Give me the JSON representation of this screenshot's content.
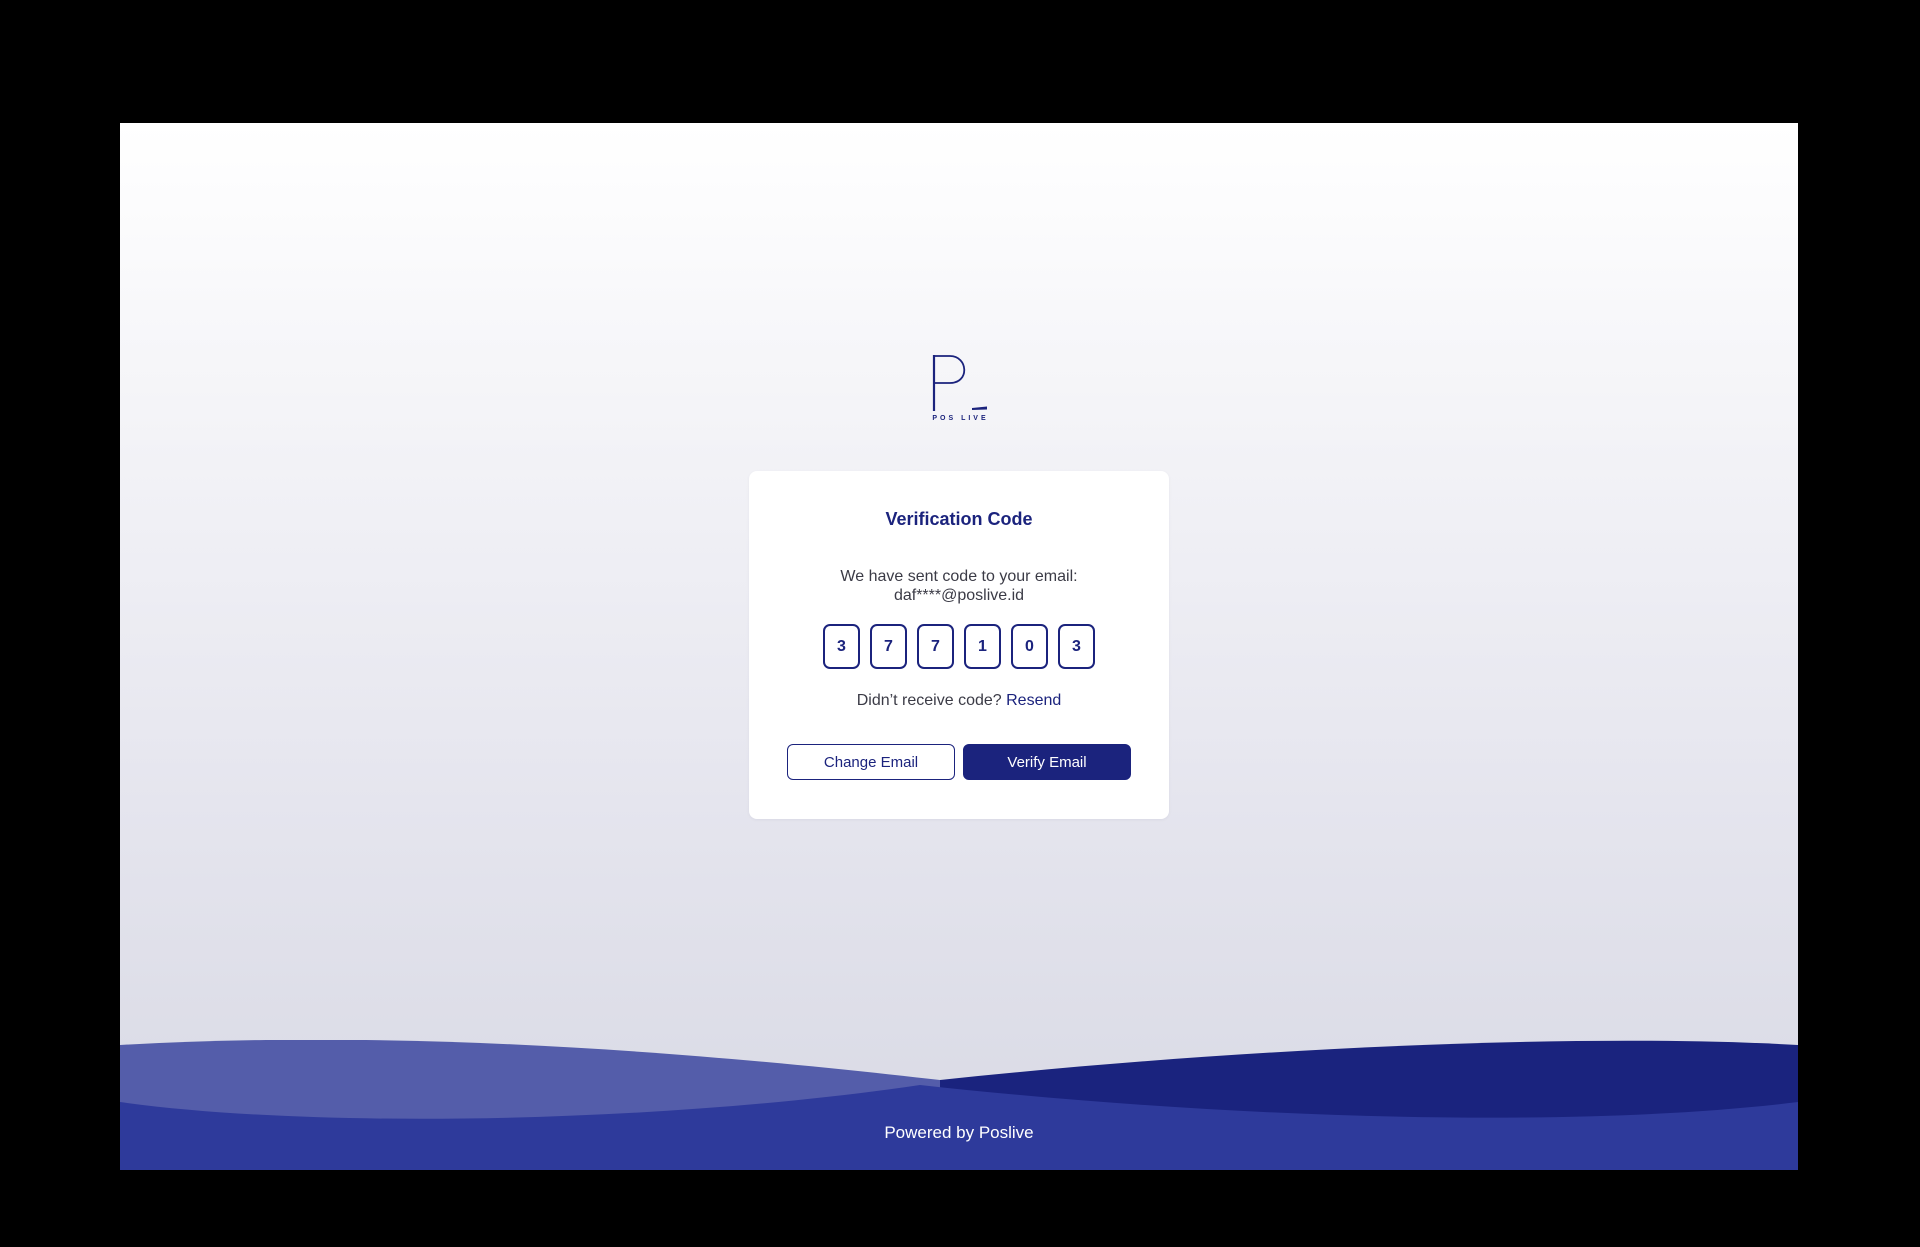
{
  "brand": {
    "logo_letter": "P",
    "logo_wordmark": "POS LIVE",
    "primary_color": "#1b237d",
    "wave_light_color": "#545daa",
    "wave_mid_color": "#2e3a9b",
    "wave_dark_color": "#1a237e"
  },
  "card": {
    "title": "Verification Code",
    "description_line1": "We have sent code to your email:",
    "description_line2": "daf****@poslive.id",
    "code_digits": [
      "3",
      "7",
      "7",
      "1",
      "0",
      "3"
    ],
    "resend_prompt": "Didn’t receive code?",
    "resend_link": "Resend",
    "change_email_label": "Change Email",
    "verify_email_label": "Verify Email"
  },
  "footer": {
    "text": "Powered by Poslive"
  }
}
